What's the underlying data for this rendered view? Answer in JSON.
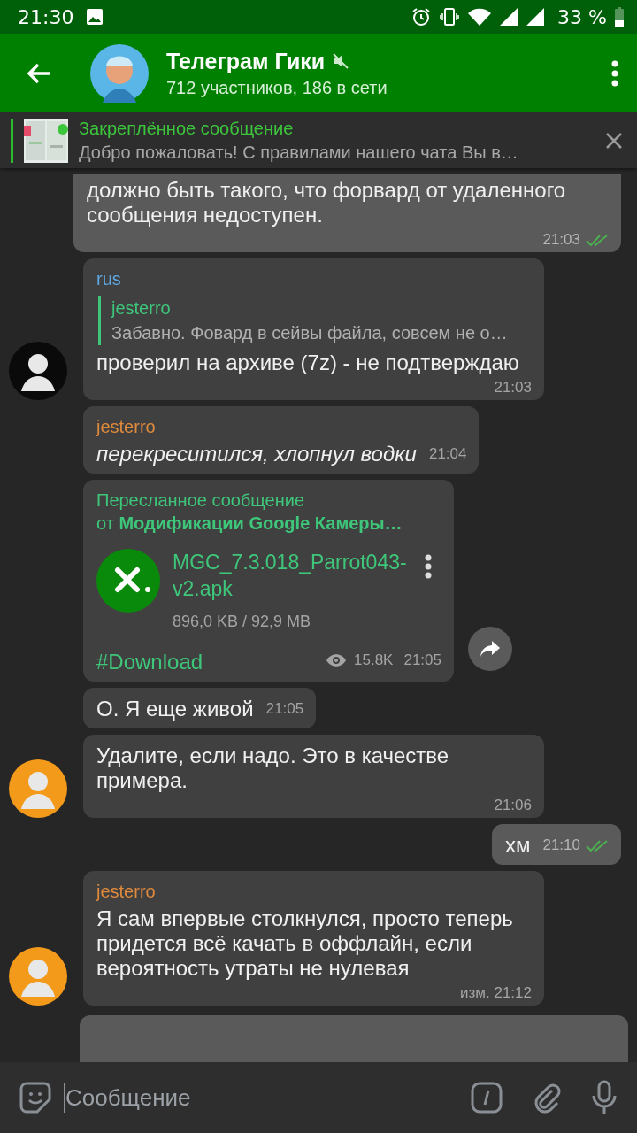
{
  "status_bar": {
    "time": "21:30",
    "battery": "33 %"
  },
  "header": {
    "title": "Телеграм Гики",
    "muted": true,
    "subtitle": "712 участников, 186 в сети"
  },
  "pinned": {
    "title": "Закреплённое сообщение",
    "text": "Добро пожаловать! С правилами нашего чата Вы в…"
  },
  "messages": [
    {
      "kind": "out",
      "text": "должно быть такого, что форвард от удаленного сообщения недоступен.",
      "time": "21:03",
      "read": true
    },
    {
      "kind": "in",
      "sender": "rus",
      "color": "#5ea7e0",
      "reply": {
        "name": "jesterro",
        "text": "Забавно. Фовард в сейвы файла, совсем не о…"
      },
      "text": "проверил на архиве (7z) - не подтверждаю",
      "time": "21:03",
      "avatar": {
        "color": "#0a0a0a"
      }
    },
    {
      "kind": "in",
      "sender": "jesterro",
      "color": "#e08a3c",
      "text": "перекреситился, хлопнул водки",
      "italic": true,
      "time": "21:04"
    },
    {
      "kind": "file",
      "forwarded_label": "Пересланное сообщение",
      "forwarded_from": "от **Модификации Google Камеры…**",
      "file_name": "MGC_7.3.018_Parrot043-v2.apk",
      "file_size": "896,0 KB / 92,9 MB",
      "caption": "#Download",
      "views": "15.8K",
      "time": "21:05"
    },
    {
      "kind": "in",
      "text": "О. Я еще живой",
      "time": "21:05"
    },
    {
      "kind": "in",
      "text": "Удалите, если надо. Это в качестве примера.",
      "time": "21:06",
      "avatar": {
        "color": "#f39a1b"
      }
    },
    {
      "kind": "out",
      "text": "хм",
      "time": "21:10",
      "read": true
    },
    {
      "kind": "in",
      "sender": "jesterro",
      "color": "#e08a3c",
      "text": "Я сам впервые столкнулся, просто теперь придется всё качать в оффлайн, если вероятность утраты не нулевая",
      "time": "изм. 21:12",
      "avatar": {
        "color": "#f39a1b"
      }
    },
    {
      "kind": "cut"
    }
  ],
  "composer": {
    "placeholder": "Сообщение"
  }
}
